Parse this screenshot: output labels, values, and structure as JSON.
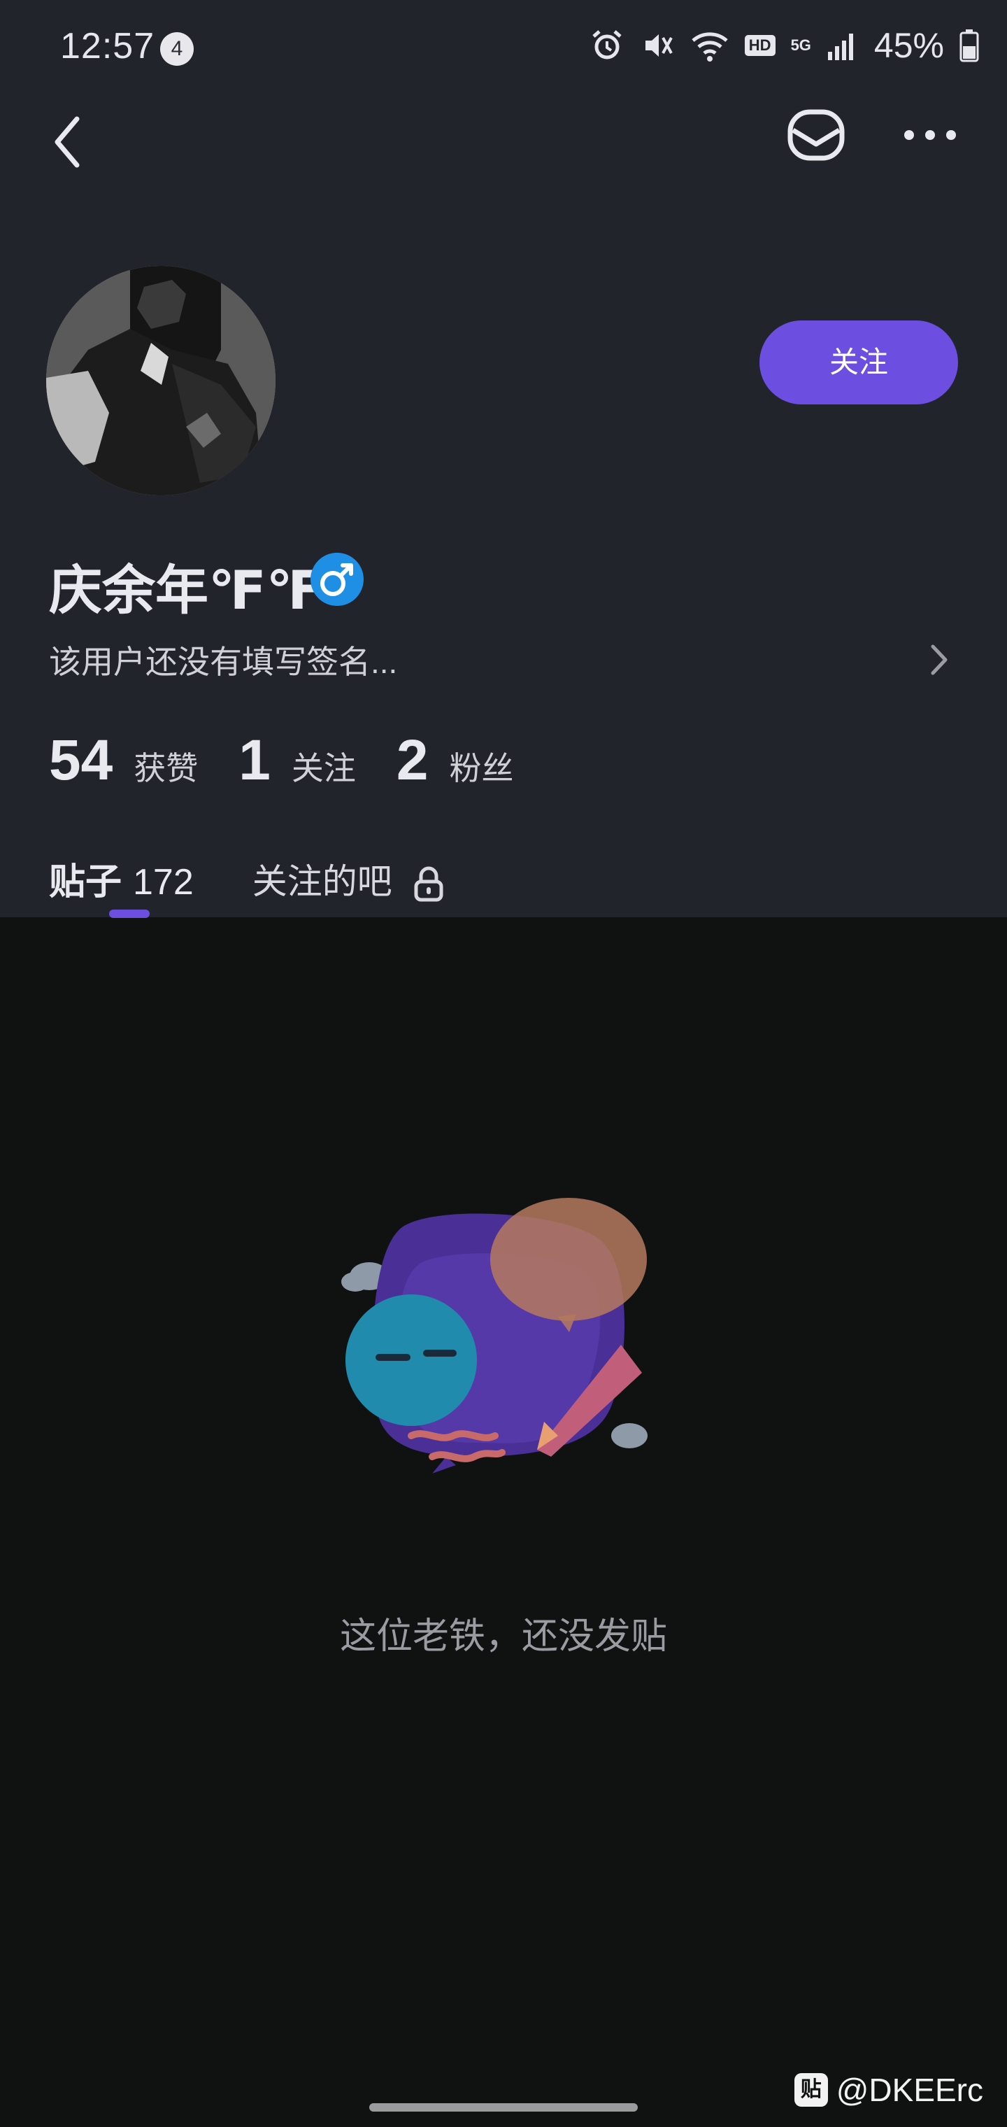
{
  "status_bar": {
    "time": "12:57",
    "notification_count": "4",
    "hd_label": "HD",
    "network_label": "5G",
    "battery_percent": "45%"
  },
  "profile": {
    "follow_label": "关注",
    "username": "庆余年℉℉",
    "gender_symbol": "♂",
    "bio": "该用户还没有填写签名...",
    "stats": [
      {
        "value": "54",
        "label": "获赞"
      },
      {
        "value": "1",
        "label": "关注"
      },
      {
        "value": "2",
        "label": "粉丝"
      }
    ]
  },
  "tabs": {
    "posts_label": "贴子",
    "posts_count": "172",
    "followed_bars_label": "关注的吧"
  },
  "empty_state": {
    "message": "这位老铁，还没发贴"
  },
  "watermark": {
    "logo_text": "贴",
    "text": "@DKEErc"
  },
  "colors": {
    "accent": "#6c4ee0",
    "header_bg": "#22242b",
    "content_bg": "#0f1211",
    "gender_badge": "#1f8fe6"
  },
  "icons": [
    "back-icon",
    "mail-icon",
    "more-icon",
    "chevron-right-icon",
    "lock-icon",
    "alarm-icon",
    "mute-icon",
    "wifi-icon",
    "signal-icon",
    "battery-icon"
  ]
}
